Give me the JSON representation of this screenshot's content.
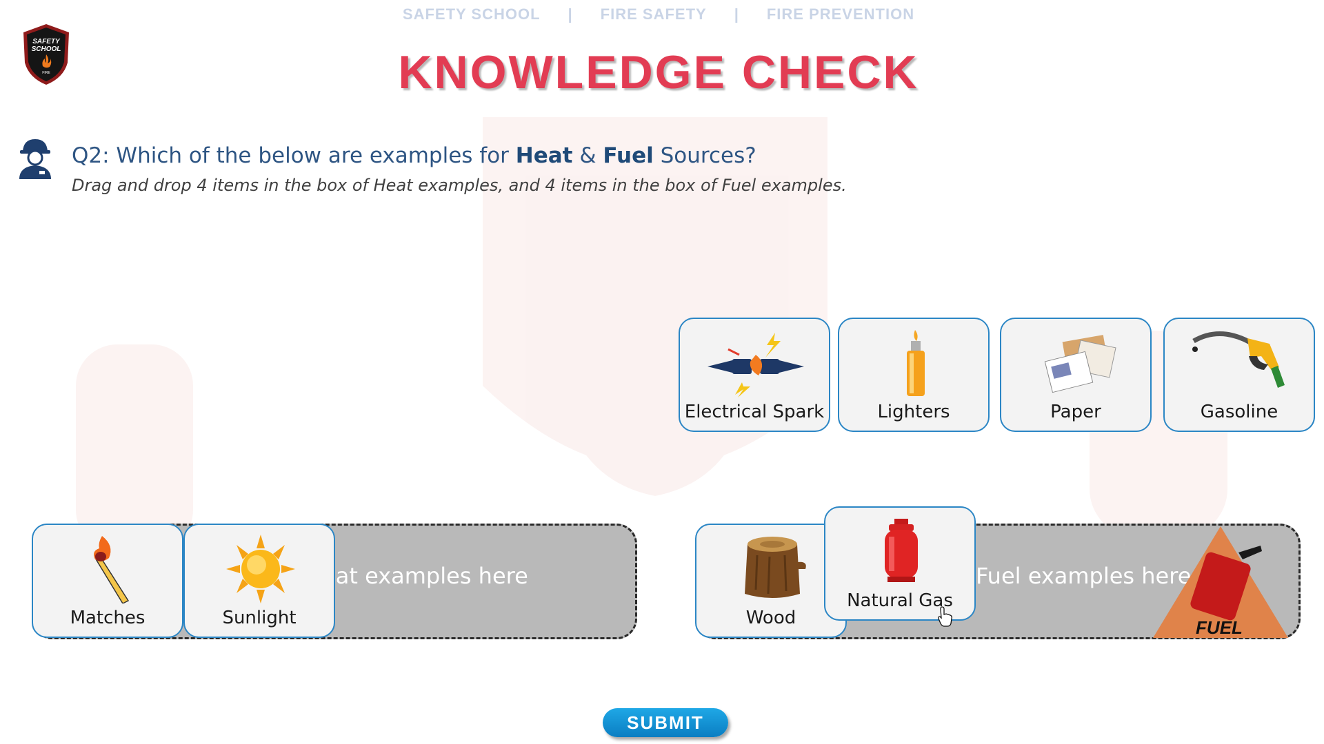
{
  "breadcrumb": [
    "SAFETY SCHOOL",
    "FIRE SAFETY",
    "FIRE PREVENTION"
  ],
  "breadcrumb_separator": "|",
  "logo": {
    "line1": "SAFETY",
    "line2": "SCHOOL",
    "line3": "FIRE"
  },
  "title": "KNOWLEDGE CHECK",
  "question": {
    "prefix": "Q2: Which of the below are examples for ",
    "heat": "Heat",
    "amp": " & ",
    "fuel": "Fuel",
    "suffix": " Sources?",
    "instruction": "Drag and drop 4 items in the box of Heat examples, and 4 items in the box of Fuel examples."
  },
  "options": [
    {
      "label": "Electrical Spark",
      "icon": "electrical-spark-icon"
    },
    {
      "label": "Lighters",
      "icon": "lighter-icon"
    },
    {
      "label": "Paper",
      "icon": "paper-icon"
    },
    {
      "label": "Gasoline",
      "icon": "gasoline-nozzle-icon"
    }
  ],
  "heat_zone": {
    "hint": "Heat examples here",
    "items": [
      {
        "label": "Matches",
        "icon": "match-icon"
      },
      {
        "label": "Sunlight",
        "icon": "sun-icon"
      }
    ]
  },
  "fuel_zone": {
    "hint": "Fuel examples here",
    "badge_text": "FUEL",
    "items": [
      {
        "label": "Wood",
        "icon": "wood-log-icon"
      }
    ]
  },
  "dragging_item": {
    "label": "Natural Gas",
    "icon": "gas-cylinder-icon"
  },
  "submit_label": "SUBMIT",
  "colors": {
    "title": "#e23c53",
    "question": "#2e5583",
    "card_border": "#2b86c5",
    "drop_zone": "#b9b9b9",
    "submit": "#0a7ec2"
  }
}
